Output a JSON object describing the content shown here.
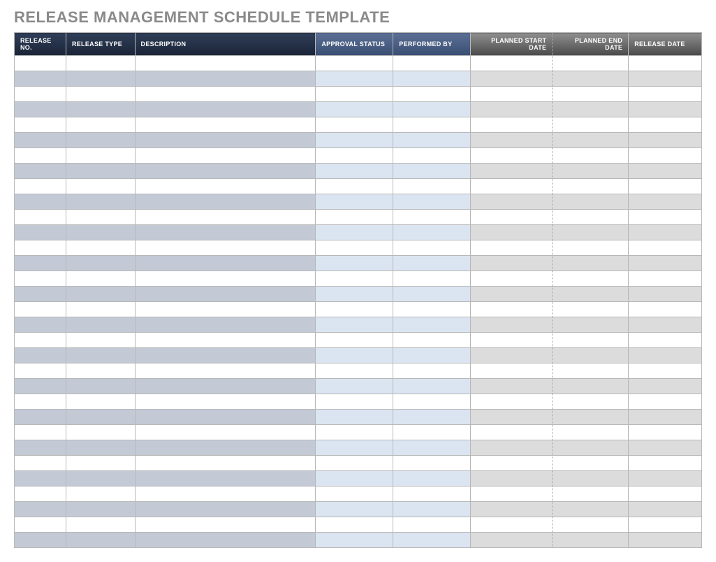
{
  "title": "RELEASE MANAGEMENT SCHEDULE TEMPLATE",
  "columns": [
    "RELEASE NO.",
    "RELEASE TYPE",
    "DESCRIPTION",
    "APPROVAL STATUS",
    "PERFORMED BY",
    "PLANNED START DATE",
    "PLANNED END DATE",
    "RELEASE DATE"
  ],
  "rows": [
    [
      "",
      "",
      "",
      "",
      "",
      "",
      "",
      ""
    ],
    [
      "",
      "",
      "",
      "",
      "",
      "",
      "",
      ""
    ],
    [
      "",
      "",
      "",
      "",
      "",
      "",
      "",
      ""
    ],
    [
      "",
      "",
      "",
      "",
      "",
      "",
      "",
      ""
    ],
    [
      "",
      "",
      "",
      "",
      "",
      "",
      "",
      ""
    ],
    [
      "",
      "",
      "",
      "",
      "",
      "",
      "",
      ""
    ],
    [
      "",
      "",
      "",
      "",
      "",
      "",
      "",
      ""
    ],
    [
      "",
      "",
      "",
      "",
      "",
      "",
      "",
      ""
    ],
    [
      "",
      "",
      "",
      "",
      "",
      "",
      "",
      ""
    ],
    [
      "",
      "",
      "",
      "",
      "",
      "",
      "",
      ""
    ],
    [
      "",
      "",
      "",
      "",
      "",
      "",
      "",
      ""
    ],
    [
      "",
      "",
      "",
      "",
      "",
      "",
      "",
      ""
    ],
    [
      "",
      "",
      "",
      "",
      "",
      "",
      "",
      ""
    ],
    [
      "",
      "",
      "",
      "",
      "",
      "",
      "",
      ""
    ],
    [
      "",
      "",
      "",
      "",
      "",
      "",
      "",
      ""
    ],
    [
      "",
      "",
      "",
      "",
      "",
      "",
      "",
      ""
    ],
    [
      "",
      "",
      "",
      "",
      "",
      "",
      "",
      ""
    ],
    [
      "",
      "",
      "",
      "",
      "",
      "",
      "",
      ""
    ],
    [
      "",
      "",
      "",
      "",
      "",
      "",
      "",
      ""
    ],
    [
      "",
      "",
      "",
      "",
      "",
      "",
      "",
      ""
    ],
    [
      "",
      "",
      "",
      "",
      "",
      "",
      "",
      ""
    ],
    [
      "",
      "",
      "",
      "",
      "",
      "",
      "",
      ""
    ],
    [
      "",
      "",
      "",
      "",
      "",
      "",
      "",
      ""
    ],
    [
      "",
      "",
      "",
      "",
      "",
      "",
      "",
      ""
    ],
    [
      "",
      "",
      "",
      "",
      "",
      "",
      "",
      ""
    ],
    [
      "",
      "",
      "",
      "",
      "",
      "",
      "",
      ""
    ],
    [
      "",
      "",
      "",
      "",
      "",
      "",
      "",
      ""
    ],
    [
      "",
      "",
      "",
      "",
      "",
      "",
      "",
      ""
    ],
    [
      "",
      "",
      "",
      "",
      "",
      "",
      "",
      ""
    ],
    [
      "",
      "",
      "",
      "",
      "",
      "",
      "",
      ""
    ],
    [
      "",
      "",
      "",
      "",
      "",
      "",
      "",
      ""
    ],
    [
      "",
      "",
      "",
      "",
      "",
      "",
      "",
      ""
    ]
  ]
}
